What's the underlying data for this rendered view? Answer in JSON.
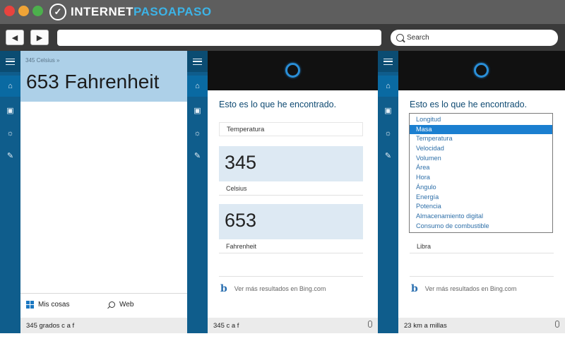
{
  "browser": {
    "logo_text_a": "INTERNET",
    "logo_text_b": "PASOAPASO",
    "back_icon": "back-arrow-icon",
    "forward_icon": "forward-arrow-icon",
    "search_placeholder": "Search",
    "url": ""
  },
  "rail_icons": [
    "hamburger-icon",
    "home-icon",
    "notebook-icon",
    "lightbulb-icon",
    "feedback-icon"
  ],
  "panel1": {
    "query_small": "345 Celsius »",
    "answer": "653 Fahrenheit",
    "mis_cosas": "Mis cosas",
    "web": "Web",
    "query": "345 grados c a f"
  },
  "panel2": {
    "found": "Esto es lo que he encontrado.",
    "category": "Temperatura",
    "value1": "345",
    "unit1": "Celsius",
    "value2": "653",
    "unit2": "Fahrenheit",
    "bing": "Ver más resultados en Bing.com",
    "query": "345 c a f"
  },
  "panel3": {
    "found": "Esto es lo que he encontrado.",
    "options": [
      "Longitud",
      "Masa",
      "Temperatura",
      "Velocidad",
      "Volumen",
      "Área",
      "Hora",
      "Ángulo",
      "Energía",
      "Potencia",
      "Almacenamiento digital",
      "Consumo de combustible"
    ],
    "selected_index": 1,
    "unit": "Libra",
    "bing": "Ver más resultados en Bing.com",
    "query": "23 km a millas"
  },
  "colors": {
    "rail": "#0f5d8c",
    "answer_bg": "#add0e8",
    "accent": "#1b7fd0",
    "cortana_ring": "#2a8fd8"
  }
}
